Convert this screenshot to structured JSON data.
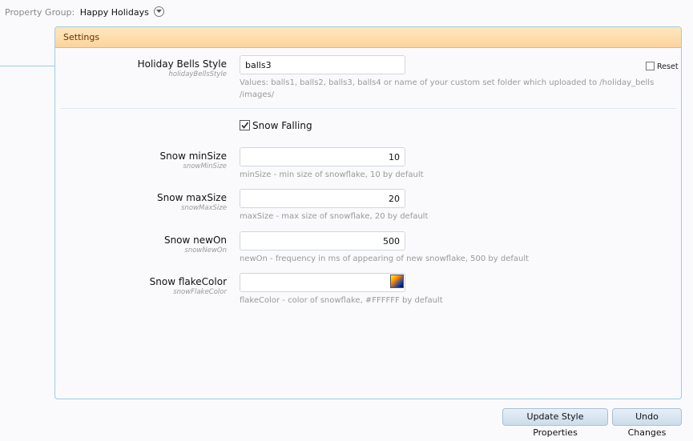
{
  "property_group": {
    "label": "Property Group:",
    "value": "Happy Holidays"
  },
  "panel": {
    "title": "Settings"
  },
  "reset": {
    "label": "Reset",
    "checked": false
  },
  "fields": {
    "bells": {
      "label": "Holiday Bells Style",
      "key": "holidayBellsStyle",
      "value": "balls3",
      "hint": "Values: balls1, balls2, balls3, balls4 or name of your custom set folder which uploaded to /holiday_bells /images/"
    },
    "snow_falling": {
      "label": "Snow Falling",
      "checked": true
    },
    "min_size": {
      "label": "Snow minSize",
      "key": "snowMinSize",
      "value": "10",
      "hint": "minSize - min size of snowflake, 10 by default"
    },
    "max_size": {
      "label": "Snow maxSize",
      "key": "snowMaxSize",
      "value": "20",
      "hint": "maxSize - max size of snowflake, 20 by default"
    },
    "new_on": {
      "label": "Snow newOn",
      "key": "snowNewOn",
      "value": "500",
      "hint": "newOn - frequency in ms of appearing of new snowflake, 500 by default"
    },
    "flake_color": {
      "label": "Snow flakeColor",
      "key": "snowFlakeColor",
      "value": "",
      "hint": "flakeColor - color of snowflake, #FFFFFF by default"
    }
  },
  "buttons": {
    "update": "Update Style Properties",
    "undo": "Undo Changes"
  },
  "colors": {
    "accent_border": "#9fcbe0",
    "header_bg": "#fcd49d",
    "header_text": "#6b2f00"
  }
}
